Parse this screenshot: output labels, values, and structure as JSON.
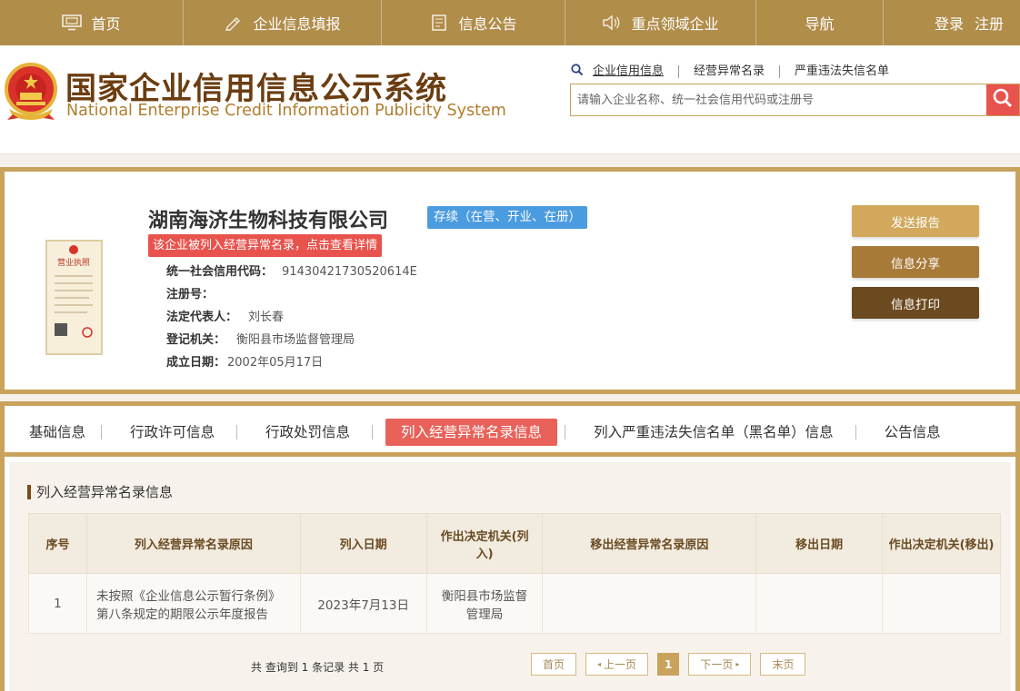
{
  "nav": {
    "items": [
      {
        "label": "首页",
        "icon": "monitor-icon"
      },
      {
        "label": "企业信息填报",
        "icon": "pen-icon"
      },
      {
        "label": "信息公告",
        "icon": "document-icon"
      },
      {
        "label": "重点领域企业",
        "icon": "speaker-icon"
      },
      {
        "label": "导航",
        "icon": ""
      }
    ],
    "login": "登录",
    "register": "注册"
  },
  "header": {
    "title_cn": "国家企业信用信息公示系统",
    "title_en": "National Enterprise Credit Information Publicity System",
    "search_tabs": [
      "企业信用信息",
      "经营异常名录",
      "严重违法失信名单"
    ],
    "search_placeholder": "请输入企业名称、统一社会信用代码或注册号"
  },
  "company": {
    "name": "湖南海济生物科技有限公司",
    "status": "存续（在营、开业、在册）",
    "alert": "该企业被列入经营异常名录，点击查看详情",
    "fields": [
      {
        "label": "统一社会信用代码：",
        "value": "91430421730520614E"
      },
      {
        "label": "注册号：",
        "value": ""
      },
      {
        "label": "法定代表人：",
        "value": "刘长春"
      },
      {
        "label": "登记机关：",
        "value": "衡阳县市场监督管理局"
      },
      {
        "label": "成立日期：",
        "value": "2002年05月17日"
      }
    ],
    "license_title": "营业执照",
    "actions": [
      {
        "label": "发送报告",
        "color": "#d2a85c"
      },
      {
        "label": "信息分享",
        "color": "#a77a37"
      },
      {
        "label": "信息打印",
        "color": "#6b4a1f"
      }
    ]
  },
  "tabs": [
    "基础信息",
    "行政许可信息",
    "行政处罚信息",
    "列入经营异常名录信息",
    "列入严重违法失信名单（黑名单）信息",
    "公告信息"
  ],
  "active_tab_index": 3,
  "section": {
    "title": "列入经营异常名录信息",
    "columns": [
      "序号",
      "列入经营异常名录原因",
      "列入日期",
      "作出决定机关(列入)",
      "移出经营异常名录原因",
      "移出日期",
      "作出决定机关(移出)"
    ],
    "rows": [
      [
        "1",
        "未按照《企业信息公示暂行条例》第八条规定的期限公示年度报告",
        "2023年7月13日",
        "衡阳县市场监督管理局",
        "",
        "",
        ""
      ]
    ]
  },
  "pager": {
    "summary": "共 查询到 1 条记录 共 1 页",
    "first": "首页",
    "prev": "上一页",
    "current": "1",
    "next": "下一页",
    "last": "末页"
  },
  "colors": {
    "brand_gold": "#b18d4a",
    "border_gold": "#c9a25c",
    "alert_red": "#e8534d",
    "status_blue": "#4a9be0"
  }
}
